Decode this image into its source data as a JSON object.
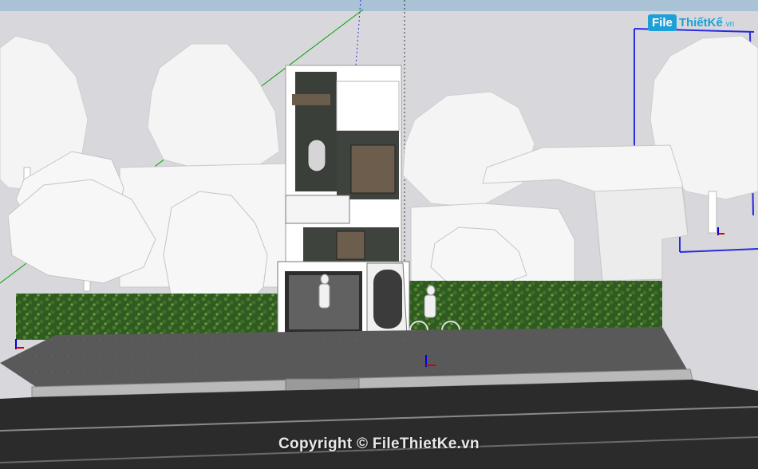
{
  "viewport": {
    "label": "SketchUp model viewport",
    "sky_color": "#d8d8dc",
    "top_band_color": "#a9c2d6",
    "axis_colors": {
      "red": "#d40000",
      "green": "#00a000",
      "blue": "#0000e0"
    }
  },
  "watermark": {
    "logo_box": "File",
    "logo_text": "ThiếtKế",
    "logo_suffix": ".vn",
    "copyright": "Copyright © FileThietKe.vn",
    "brand_color": "#1d9fd8"
  },
  "scene": {
    "house_main_color": "#ffffff",
    "house_facade_dark": "#3a3d38",
    "hedge_color": "#2f5a22",
    "sidewalk_color": "#5c5c5c",
    "road_color": "#2b2b2b",
    "trees_color": "#f2f2f2"
  }
}
